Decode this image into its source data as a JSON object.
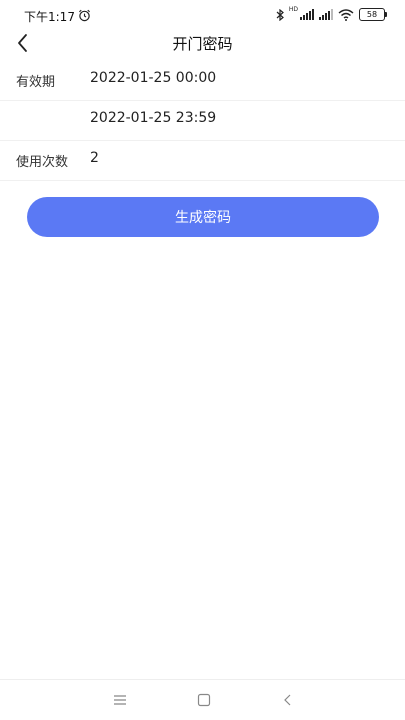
{
  "status_bar": {
    "time": "下午1:17",
    "network_label": "HD",
    "battery": "58"
  },
  "header": {
    "title": "开门密码",
    "back_icon": "chevron-left-icon"
  },
  "form": {
    "validity_label": "有效期",
    "start_time": "2022-01-25 00:00",
    "end_time": "2022-01-25 23:59",
    "usage_label": "使用次数",
    "usage_count": "2"
  },
  "actions": {
    "generate_label": "生成密码"
  },
  "bottom_nav": [
    "menu-icon",
    "home-icon",
    "back-icon"
  ],
  "colors": {
    "accent": "#5b79f4",
    "divider": "#f0f0f0"
  }
}
